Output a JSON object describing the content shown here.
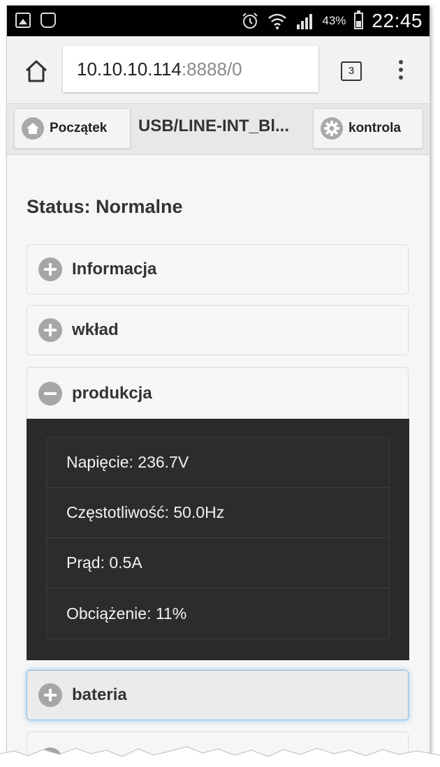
{
  "status_bar": {
    "battery_pct": "43%",
    "time": "22:45"
  },
  "browser": {
    "url_host": "10.10.10.114",
    "url_rest": ":8888/0",
    "tab_count": "3"
  },
  "header": {
    "home_label": "Początek",
    "title": "USB/LINE-INT_Bl...",
    "control_label": "kontrola"
  },
  "status_title": "Status: Normalne",
  "sections": {
    "info": "Informacja",
    "input": "wkład",
    "output": "produkcja",
    "battery": "bateria"
  },
  "output_rows": [
    "Napięcie: 236.7V",
    "Częstotliwość: 50.0Hz",
    "Prąd: 0.5A",
    "Obciążenie: 11%"
  ]
}
